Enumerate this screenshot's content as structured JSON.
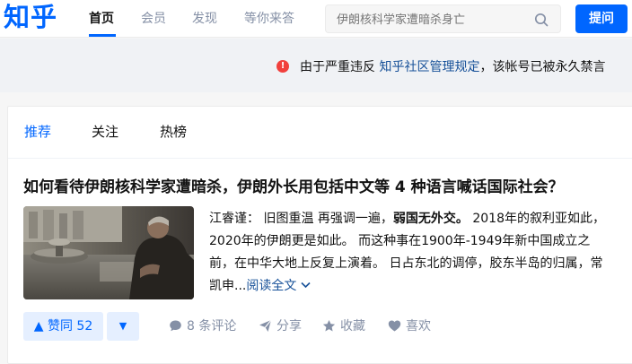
{
  "header": {
    "logo": "知乎",
    "nav": [
      "首页",
      "会员",
      "发现",
      "等你来答"
    ],
    "search_placeholder": "伊朗核科学家遭暗杀身亡",
    "ask_button": "提问"
  },
  "notice": {
    "text_before": "由于严重违反 ",
    "link": "知乎社区管理规定",
    "text_after": "，该帐号已被永久禁言"
  },
  "feed": {
    "tabs": [
      "推荐",
      "关注",
      "热榜"
    ],
    "item": {
      "title": "如何看待伊朗核科学家遭暗杀，伊朗外长用包括中文等 4 种语言喊话国际社会？",
      "author": "江睿谨：",
      "excerpt_1": " 旧图重温 再强调一遍，",
      "excerpt_bold": "弱国无外交。",
      "excerpt_2": " 2018年的叙利亚如此，2020年的伊朗更是如此。 而这种事在1900年-1949年新中国成立之前，在中华大地上反复上演着。 日占东北的调停，胶东半岛的归属，常凯申...",
      "read_more": "阅读全文",
      "vote_label": "▲ 赞同 52",
      "comments": "8 条评论",
      "share": "分享",
      "favorite": "收藏",
      "like": "喜欢"
    }
  },
  "colors": {
    "brand": "#0066ff",
    "link": "#175199",
    "warning": "#f1403c"
  }
}
